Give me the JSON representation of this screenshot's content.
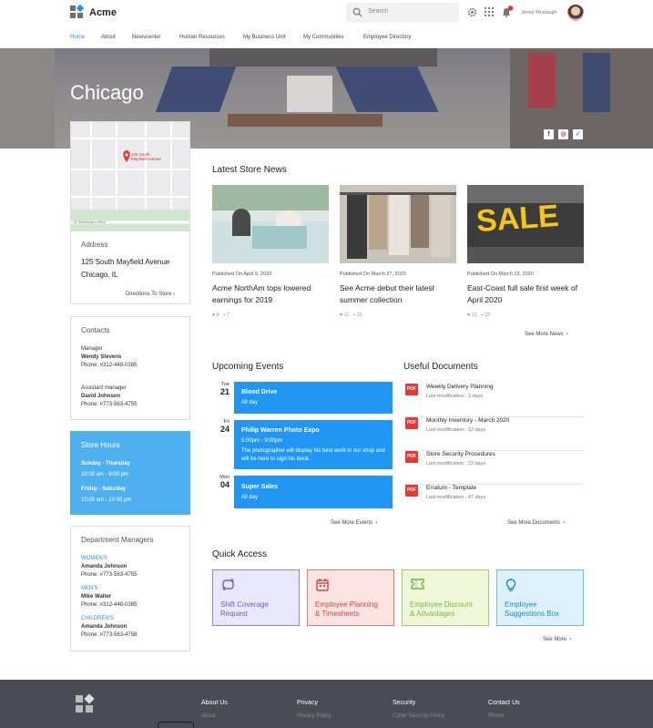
{
  "header": {
    "brand": "Acme",
    "search_placeholder": "Search",
    "user_name": "Jenny Murtaugh"
  },
  "nav": [
    "Home",
    "About",
    "Newscenter",
    "Human Resources",
    "My Business Unit",
    "My Communities",
    "Employee Directory"
  ],
  "hero": {
    "title": "Chicago"
  },
  "map": {
    "pin_label_1": "125 South",
    "pin_label_2": "Mayfield Avenue",
    "street_1": "W Washington Blvd"
  },
  "address": {
    "heading": "Address",
    "line1": "125 South Mayfield Avenue",
    "line2": "Chicago, IL",
    "directions": "Directions To Store"
  },
  "contacts": {
    "heading": "Contacts",
    "people": [
      {
        "role": "Manager",
        "name": "Wendy Stevens",
        "phone": "Phone: #312-448-0385"
      },
      {
        "role": "Assistant manager",
        "name": "David Johnson",
        "phone": "Phone: #773-563-4755"
      }
    ]
  },
  "store_hours": {
    "heading": "Store Hours",
    "rows": [
      {
        "days": "Sunday - Thursday",
        "hours": "10:00 am - 9:00 pm"
      },
      {
        "days": "Friday - Saturday",
        "hours": "10:00 am - 10:00 pm"
      }
    ]
  },
  "dept": {
    "heading": "Department Managers",
    "rows": [
      {
        "dept": "WOMEN'S",
        "name": "Amanda Johnson",
        "phone": "Phone: #773-563-4755"
      },
      {
        "dept": "MEN'S",
        "name": "Mike Walter",
        "phone": "Phone: #312-448-0385"
      },
      {
        "dept": "CHILDREN'S",
        "name": "Amanda Johnson",
        "phone": "Phone: #773-563-4758"
      }
    ]
  },
  "news": {
    "heading": "Latest Store News",
    "items": [
      {
        "published": "Published On April 9, 2020",
        "title": "Acme NorthAm tops lowered earnings for 2019",
        "likes": "8",
        "comments": "7"
      },
      {
        "published": "Published On March 27, 2020",
        "title": "See Acme debut their latest summer collection",
        "likes": "11",
        "comments": "15"
      },
      {
        "published": "Published On March 13, 2020",
        "title": "East-Coast full sale first week of April 2020",
        "likes": "21",
        "comments": "32"
      }
    ],
    "sale_word": "SALE",
    "see_more": "See More News"
  },
  "events": {
    "heading": "Upcoming Events",
    "items": [
      {
        "dow": "Tue",
        "day": "21",
        "title": "Blood Drive",
        "time": "All day",
        "desc": ""
      },
      {
        "dow": "Fri",
        "day": "24",
        "title": "Philip Warren Photo Expo",
        "time": "5:00pm - 9:00pm",
        "desc": "The photographer will display his best work in our shop and will be here to sign his book."
      },
      {
        "dow": "Mon",
        "day": "04",
        "title": "Super Sales",
        "time": "All day",
        "desc": ""
      }
    ],
    "see_more": "See More Events"
  },
  "documents": {
    "heading": "Useful Documents",
    "items": [
      {
        "title": "Weekly Delivery Planning",
        "meta": "Last modification : 3 days"
      },
      {
        "title": "Monthly Inventory - March 2020",
        "meta": "Last modification : 12 days"
      },
      {
        "title": "Store Security Procedures",
        "meta": "Last modification : 23 days"
      },
      {
        "title": "Erratum - Template",
        "meta": "Last modification : 47 days"
      }
    ],
    "pdf": "PDF",
    "see_more": "See More Documents"
  },
  "quick": {
    "heading": "Quick Access",
    "items": [
      {
        "l1": "Shift Coverage",
        "l2": "Request",
        "color": "#6b5fd3",
        "bg": "#e9e7fb",
        "icon": "swap-icon"
      },
      {
        "l1": "Employee Planning",
        "l2": "& Timesheets",
        "color": "#d64545",
        "bg": "#fde3e1",
        "icon": "calendar-icon"
      },
      {
        "l1": "Employee Discount",
        "l2": "& Advantages",
        "color": "#7cb342",
        "bg": "#eef8d8",
        "icon": "ticket-icon"
      },
      {
        "l1": "Employee",
        "l2": "Suggestions Box",
        "color": "#1e88c9",
        "bg": "#dcf1fb",
        "icon": "lightbulb-icon"
      }
    ],
    "see_more": "See More"
  },
  "footer": {
    "cols": [
      {
        "h": "About Us",
        "items": [
          "About"
        ]
      },
      {
        "h": "Privacy",
        "items": [
          "Privacy Policy"
        ]
      },
      {
        "h": "Security",
        "items": [
          "Cyber Security Policy"
        ]
      },
      {
        "h": "Contact Us",
        "items": [
          "Phone"
        ]
      }
    ]
  }
}
